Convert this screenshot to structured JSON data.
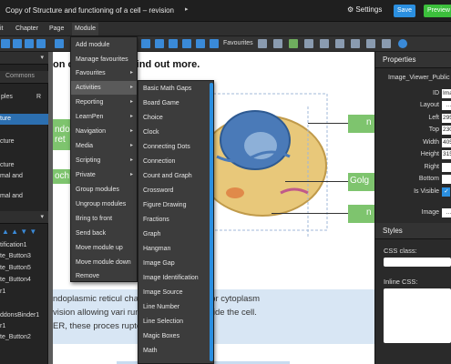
{
  "titlebar": {
    "title": "Copy of Structure and functioning of a cell – revision",
    "caret": "▸",
    "settings_label": "Settings",
    "save_label": "Save",
    "preview_label": "Preview"
  },
  "menubar": {
    "items": [
      "it",
      "Chapter",
      "Page",
      "Module"
    ]
  },
  "toolbar": {
    "favourites_label": "Favourites"
  },
  "left_panel": {
    "caret": "▾",
    "commons_label": "Commons",
    "items": [
      "ples",
      "R",
      "ture",
      "cture",
      "cture",
      "mal and",
      "mal and",
      "tification1",
      "te_Button3",
      "te_Button5",
      "te_Button4",
      "r1",
      "ddonsBinder1",
      "r1",
      "te_Button2"
    ]
  },
  "page": {
    "heading": "on          organelles to find out more.",
    "green_left_1": "ndop",
    "green_left_1b": "ret",
    "green_left_2": "och",
    "green_right_1": "n",
    "green_right_2": "Golg",
    "green_right_3": "n",
    "text_lines": [
      "ndoplasmic reticul             channels responsible for cytoplasm",
      "vision allowing vari            run simultaneously inside the cell.",
      " ER, these proces               rupted."
    ]
  },
  "module_menu": {
    "items": [
      {
        "label": "Add module",
        "arrow": ""
      },
      {
        "label": "Manage favourites",
        "arrow": ""
      },
      {
        "label": "Favourites",
        "arrow": "▸"
      },
      {
        "label": "Activities",
        "arrow": "▸"
      },
      {
        "label": "Reporting",
        "arrow": "▸"
      },
      {
        "label": "LearnPen",
        "arrow": "▸"
      },
      {
        "label": "Navigation",
        "arrow": "▸"
      },
      {
        "label": "Media",
        "arrow": "▸"
      },
      {
        "label": "Scripting",
        "arrow": "▸"
      },
      {
        "label": "Private",
        "arrow": "▸"
      },
      {
        "label": "Group modules",
        "arrow": ""
      },
      {
        "label": "Ungroup modules",
        "arrow": ""
      },
      {
        "label": "Bring to front",
        "arrow": ""
      },
      {
        "label": "Send back",
        "arrow": ""
      },
      {
        "label": "Move module up",
        "arrow": ""
      },
      {
        "label": "Move module down",
        "arrow": ""
      },
      {
        "label": "Remove",
        "arrow": ""
      }
    ]
  },
  "activities_menu": {
    "items": [
      "Basic Math Gaps",
      "Board Game",
      "Choice",
      "Clock",
      "Connecting Dots",
      "Connection",
      "Count and Graph",
      "Crossword",
      "Figure Drawing",
      "Fractions",
      "Graph",
      "Hangman",
      "Image Gap",
      "Image Identification",
      "Image Source",
      "Line Number",
      "Line Selection",
      "Magic Boxes",
      "Math"
    ]
  },
  "properties": {
    "header": "Properties",
    "module_name": "Image_Viewer_Public",
    "rows": [
      {
        "label": "ID",
        "value": "Image"
      },
      {
        "label": "Layout",
        "value": "..."
      },
      {
        "label": "Left",
        "value": "295"
      },
      {
        "label": "Top",
        "value": "230"
      },
      {
        "label": "Width",
        "value": "405"
      },
      {
        "label": "Height",
        "value": "315"
      },
      {
        "label": "Right",
        "value": ""
      },
      {
        "label": "Bottom",
        "value": ""
      },
      {
        "label": "Is Visible",
        "value": "✓"
      },
      {
        "label": "Image",
        "value": "..."
      }
    ],
    "styles_header": "Styles",
    "css_class_label": "CSS class:",
    "inline_css_label": "Inline CSS:"
  },
  "colors": {
    "save": "#2b8fe0",
    "preview": "#3cbf3c",
    "selection": "#2c6fb0",
    "green_label": "#7ec46e"
  }
}
